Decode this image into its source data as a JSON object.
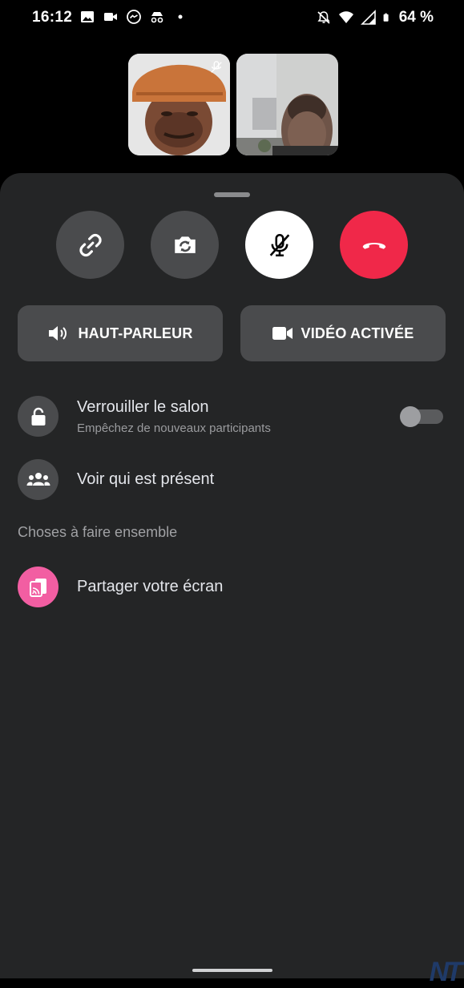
{
  "status_bar": {
    "time": "16:12",
    "battery_text": "64 %"
  },
  "call_controls": {
    "link": "link-icon",
    "flip_camera": "camera-flip-icon",
    "mute": "microphone-muted-icon",
    "end_call": "end-call-icon",
    "end_call_color": "#f02849"
  },
  "audio_video": {
    "speaker_label": "HAUT-PARLEUR",
    "video_label": "VIDÉO ACTIVÉE"
  },
  "lock_room": {
    "title": "Verrouiller le salon",
    "subtitle": "Empêchez de nouveaux participants",
    "enabled": false
  },
  "participants": {
    "title": "Voir qui est présent"
  },
  "together": {
    "section_title": "Choses à faire ensemble",
    "share_screen": "Partager votre écran",
    "share_color": "#f25ea2"
  },
  "watermark": "NT"
}
